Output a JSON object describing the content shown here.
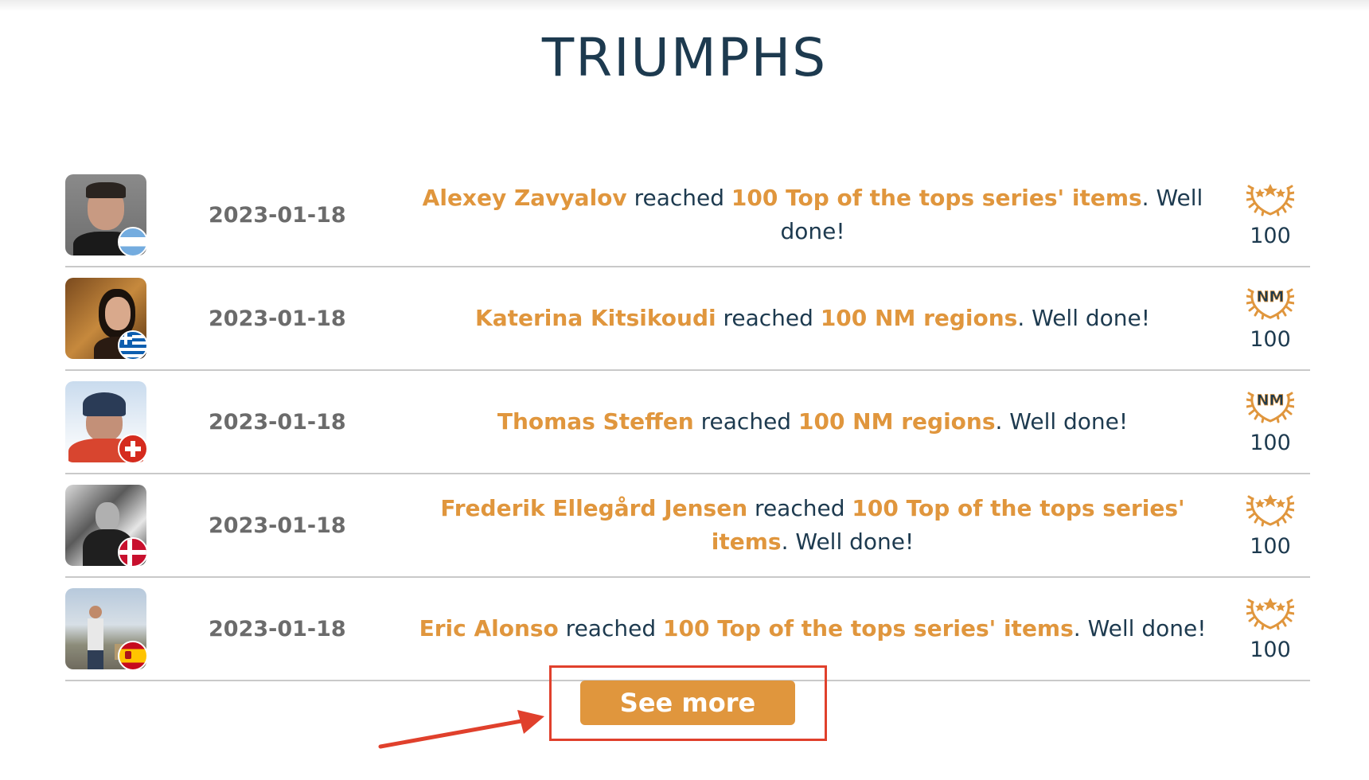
{
  "page": {
    "title": "TRIUMPHS"
  },
  "triumphs": [
    {
      "date": "2023-01-18",
      "user": "Alexey Zavyalov",
      "verb": " reached ",
      "achievement": "100 Top of the tops series' items",
      "suffix": ". Well done!",
      "badge_icon": "laurel-stars-icon",
      "badge_value": "100",
      "flag": "argentina-flag-icon"
    },
    {
      "date": "2023-01-18",
      "user": "Katerina Kitsikoudi",
      "verb": " reached ",
      "achievement": "100 NM regions",
      "suffix": ". Well done!",
      "badge_icon": "laurel-nm-icon",
      "badge_value": "100",
      "flag": "greece-flag-icon"
    },
    {
      "date": "2023-01-18",
      "user": "Thomas Steffen",
      "verb": " reached ",
      "achievement": "100 NM regions",
      "suffix": ". Well done!",
      "badge_icon": "laurel-nm-icon",
      "badge_value": "100",
      "flag": "switzerland-flag-icon"
    },
    {
      "date": "2023-01-18",
      "user": "Frederik Ellegård Jensen",
      "verb": " reached ",
      "achievement": "100 Top of the tops series' items",
      "suffix": ". Well done!",
      "badge_icon": "laurel-stars-icon",
      "badge_value": "100",
      "flag": "denmark-flag-icon"
    },
    {
      "date": "2023-01-18",
      "user": "Eric Alonso",
      "verb": " reached ",
      "achievement": "100 Top of the tops series' items",
      "suffix": ". Well done!",
      "badge_icon": "laurel-stars-icon",
      "badge_value": "100",
      "flag": "spain-flag-icon"
    }
  ],
  "see_more": {
    "label": "See more"
  },
  "colors": {
    "accent": "#e0963d",
    "title": "#1d3a4f",
    "annotation": "#e0402c",
    "divider": "#c9c9c9"
  }
}
